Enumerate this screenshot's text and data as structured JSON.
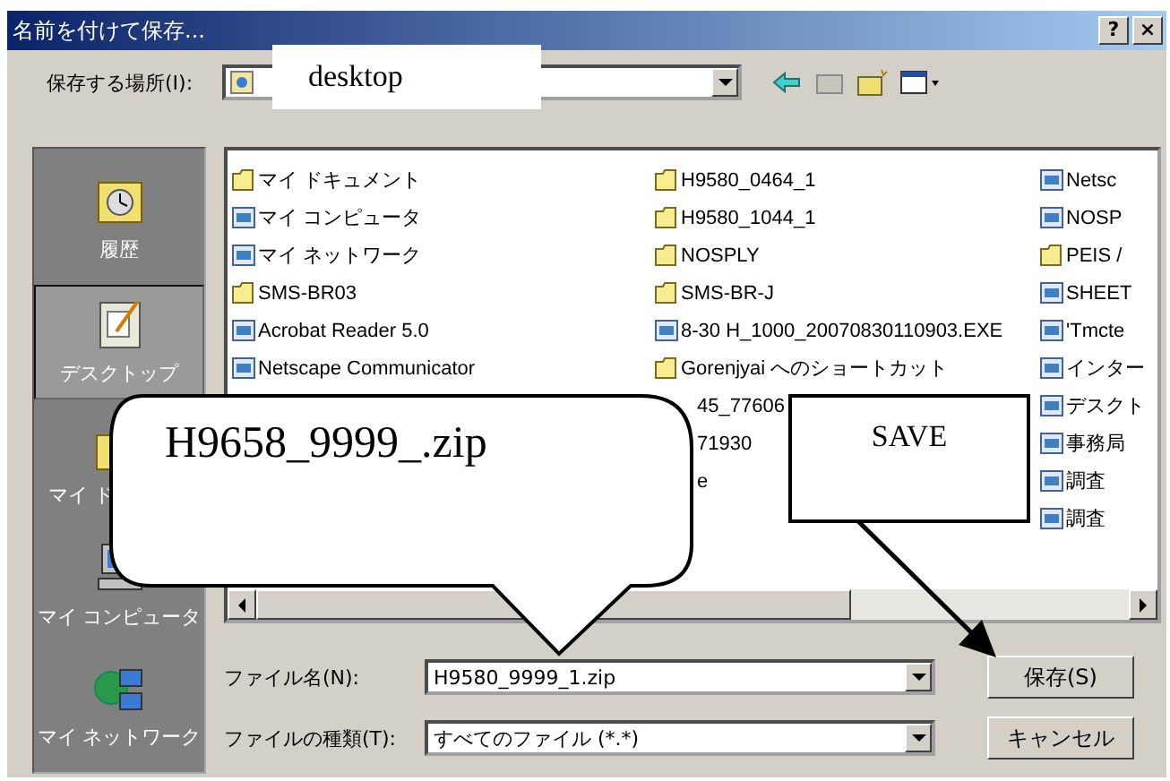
{
  "window": {
    "title": "名前を付けて保存...",
    "help_button": "?",
    "close_button": "×"
  },
  "location": {
    "label": "保存する場所(I):"
  },
  "places": [
    {
      "label": "履歴",
      "kind": "history",
      "selected": false
    },
    {
      "label": "デスクトップ",
      "kind": "desktop",
      "selected": true
    },
    {
      "label": "マイ ド",
      "kind": "documents",
      "selected": false
    },
    {
      "label": "マイ コンピュータ",
      "kind": "computer",
      "selected": false
    },
    {
      "label": "マイ ネットワーク",
      "kind": "network",
      "selected": false
    }
  ],
  "files": {
    "columns": [
      [
        {
          "name": "マイ ドキュメント",
          "kind": "folder"
        },
        {
          "name": "マイ コンピュータ",
          "kind": "file"
        },
        {
          "name": "マイ ネットワーク",
          "kind": "file"
        },
        {
          "name": "SMS-BR03",
          "kind": "folder"
        },
        {
          "name": "Acrobat Reader 5.0",
          "kind": "file"
        },
        {
          "name": "Netscape Communicator",
          "kind": "file"
        }
      ],
      [
        {
          "name": "H9580_0464_1",
          "kind": "folder"
        },
        {
          "name": "H9580_1044_1",
          "kind": "folder"
        },
        {
          "name": "NOSPLY",
          "kind": "folder"
        },
        {
          "name": "SMS-BR-J",
          "kind": "folder"
        },
        {
          "name": "8-30 H_1000_20070830110903.EXE",
          "kind": "file"
        },
        {
          "name": "Gorenjyai へのショートカット",
          "kind": "folder"
        },
        {
          "name": "45_77606",
          "kind": "partial"
        },
        {
          "name": "71930",
          "kind": "partial"
        },
        {
          "name": "e",
          "kind": "partial"
        }
      ],
      [
        {
          "name": "Netsc",
          "kind": "file"
        },
        {
          "name": "NOSP",
          "kind": "file"
        },
        {
          "name": "PEIS /",
          "kind": "folder"
        },
        {
          "name": "SHEET",
          "kind": "file"
        },
        {
          "name": "'Tmcte",
          "kind": "file"
        },
        {
          "name": "インター",
          "kind": "file"
        },
        {
          "name": "デスクト",
          "kind": "file"
        },
        {
          "name": "事務局",
          "kind": "file"
        },
        {
          "name": "調査",
          "kind": "file"
        },
        {
          "name": "調査",
          "kind": "file"
        }
      ]
    ]
  },
  "filename": {
    "label": "ファイル名(N):",
    "value": "H9580_9999_1.zip"
  },
  "filetype": {
    "label": "ファイルの種類(T):",
    "value": "すべてのファイル (*.*)"
  },
  "buttons": [
    "保存(S)",
    "キャンセル"
  ],
  "annotations": {
    "location_note": "desktop",
    "filename_callout": "H9658_9999_.zip",
    "save_note": "SAVE"
  }
}
